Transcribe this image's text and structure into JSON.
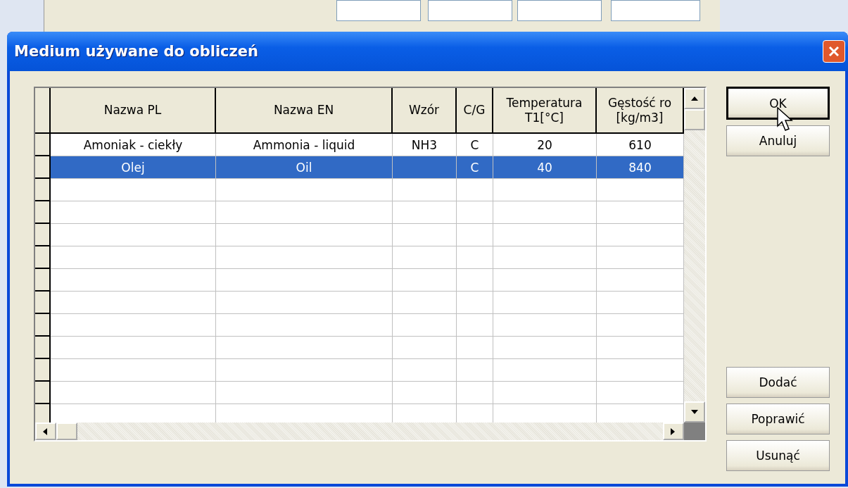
{
  "dialog": {
    "title": "Medium używane do obliczeń"
  },
  "table": {
    "columns": [
      "Nazwa PL",
      "Nazwa EN",
      "Wzór",
      "C/G",
      "Temperatura T1[°C]",
      "Gęstość ro [kg/m3]"
    ],
    "rows": [
      {
        "cells": [
          "Amoniak - ciekły",
          "Ammonia - liquid",
          "NH3",
          "C",
          "20",
          "610"
        ],
        "selected": false
      },
      {
        "cells": [
          "Olej",
          "Oil",
          "",
          "C",
          "40",
          "840"
        ],
        "selected": true
      }
    ]
  },
  "buttons": [
    {
      "label": "OK",
      "default": true
    },
    {
      "label": "Anuluj",
      "default": false
    },
    {
      "label": "Dodać",
      "default": false
    },
    {
      "label": "Poprawić",
      "default": false
    },
    {
      "label": "Usunąć",
      "default": false
    }
  ]
}
